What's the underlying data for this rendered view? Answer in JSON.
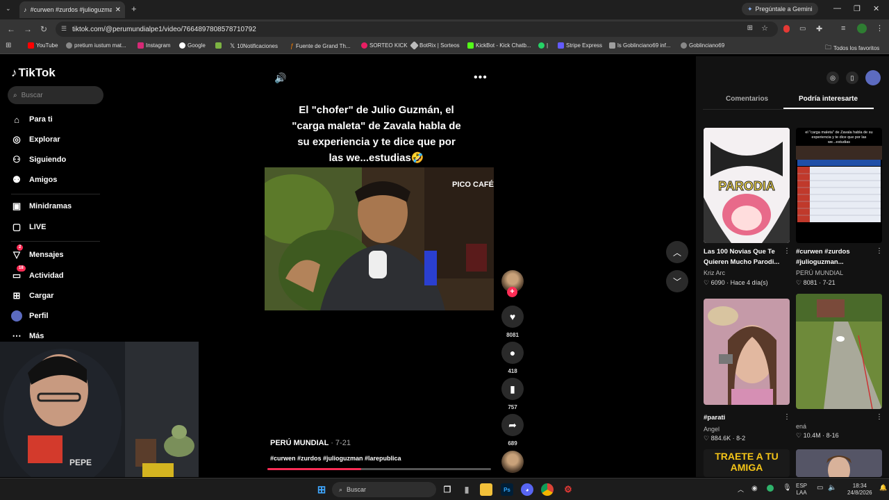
{
  "browser": {
    "tab_title": "#curwen #zurdos #julioguzman",
    "gemini_label": "Pregúntale a Gemini",
    "url": "tiktok.com/@perumundialpe1/video/7664897808578710792",
    "bookmarks": [
      "YouTube",
      "pretium iustum mat...",
      "Instagram",
      "Google",
      "10Notificaciones",
      "Fuente de Grand Th...",
      "SORTEO KICK",
      "BotRix | Sorteos",
      "KickBot - Kick Chatb...",
      "|",
      "Stripe Express",
      "ls Goblinciano69 inf...",
      "Goblinciano69"
    ],
    "all_favorites": "Todos los favoritos"
  },
  "sidebar": {
    "logo": "TikTok",
    "search_placeholder": "Buscar",
    "items": [
      {
        "label": "Para ti",
        "icon": "home-icon"
      },
      {
        "label": "Explorar",
        "icon": "compass-icon"
      },
      {
        "label": "Siguiendo",
        "icon": "following-icon"
      },
      {
        "label": "Amigos",
        "icon": "friends-icon"
      },
      {
        "label": "Minidramas",
        "icon": "film-icon"
      },
      {
        "label": "LIVE",
        "icon": "live-icon"
      },
      {
        "label": "Mensajes",
        "icon": "message-icon",
        "badge": "2"
      },
      {
        "label": "Actividad",
        "icon": "activity-icon",
        "badge": "18"
      },
      {
        "label": "Cargar",
        "icon": "upload-icon"
      },
      {
        "label": "Perfil",
        "icon": "profile-icon"
      },
      {
        "label": "Más",
        "icon": "more-icon"
      }
    ]
  },
  "video": {
    "caption": "El \"chofer\" de Julio Guzmán, el \"carga maleta\" de Zavala habla de su experiencia y te dice que por las we...estudias🤣",
    "watermark": "PICO CAFÉ",
    "author": "PERÚ MUNDIAL",
    "date": "· 7-21",
    "hashtags": "#curwen #zurdos #julioguzman #larepublica",
    "progress_fraction": 0.42,
    "likes": "8081",
    "comments": "418",
    "saves": "757",
    "shares": "689"
  },
  "right_panel": {
    "tabs": [
      "Comentarios",
      "Podría interesarte"
    ],
    "active_tab": "Podría interesarte",
    "cards": [
      {
        "title": "Las 100 Novias Que Te Quieren Mucho Parodi...",
        "author": "Kriz Arc",
        "stats": "♡ 6090 · Hace 4 día(s)",
        "thumb_text": "PARODIA"
      },
      {
        "title": "#curwen #zurdos #julioguzman...",
        "author": "PERÚ MUNDIAL",
        "stats": "♡ 8081 · 7-21",
        "thumb_text": "el \"carga maleta\" de Zavala habla de su experiencia y te dice que por las we...estudias"
      },
      {
        "title": "#parati",
        "author": "Angel",
        "stats": "♡ 884.6K · 8-2"
      },
      {
        "title": "",
        "author": "ená",
        "stats": "♡ 10.4M · 8-16"
      },
      {
        "title": "",
        "author": "",
        "stats": "",
        "thumb_text": "TRAETE A TU AMIGA"
      }
    ]
  },
  "taskbar": {
    "search_placeholder": "Buscar",
    "lang_top": "ESP",
    "lang_bottom": "LAA",
    "time": "18:34",
    "date": "24/8/2026"
  },
  "colors": {
    "accent": "#fe2c55",
    "background": "#000000",
    "panel": "#121212"
  }
}
